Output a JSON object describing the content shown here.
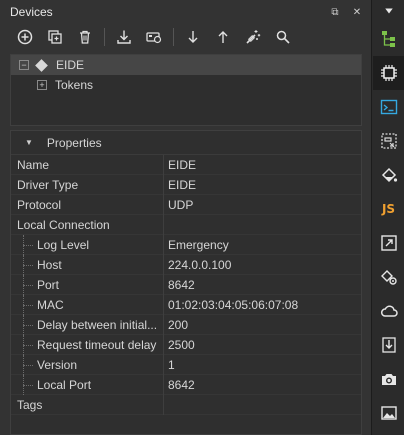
{
  "panel": {
    "title": "Devices"
  },
  "toolbar": {
    "buttons": [
      "add-icon",
      "copy-icon",
      "delete-icon",
      "download-icon",
      "device-icon",
      "arrow-down-icon",
      "arrow-up-icon",
      "magic-wand-icon",
      "search-icon"
    ]
  },
  "tree": {
    "root": {
      "label": "EIDE",
      "expander": "−"
    },
    "child": {
      "label": "Tokens",
      "expander": "+"
    }
  },
  "properties": {
    "header": "Properties",
    "rows": [
      {
        "name": "Name",
        "value": "EIDE"
      },
      {
        "name": "Driver Type",
        "value": "EIDE"
      },
      {
        "name": "Protocol",
        "value": "UDP"
      },
      {
        "name": "Local Connection",
        "value": ""
      },
      {
        "name": "Log Level",
        "value": "Emergency"
      },
      {
        "name": "Host",
        "value": "224.0.0.100"
      },
      {
        "name": "Port",
        "value": "8642"
      },
      {
        "name": "MAC",
        "value": "01:02:03:04:05:06:07:08"
      },
      {
        "name": "Delay between initial...",
        "value": "200"
      },
      {
        "name": "Request timeout delay",
        "value": "2500"
      },
      {
        "name": "Version",
        "value": "1"
      },
      {
        "name": "Local Port",
        "value": "8642"
      },
      {
        "name": "Tags",
        "value": ""
      }
    ]
  },
  "rail": {
    "items": [
      "hierarchy-icon",
      "chip-icon",
      "terminal-icon",
      "form-icon",
      "paint-bucket-icon",
      "javascript-icon",
      "external-window-icon",
      "settings-bucket-icon",
      "cloud-icon",
      "import-icon",
      "camera-icon",
      "image-icon"
    ],
    "js_label": "JS"
  }
}
